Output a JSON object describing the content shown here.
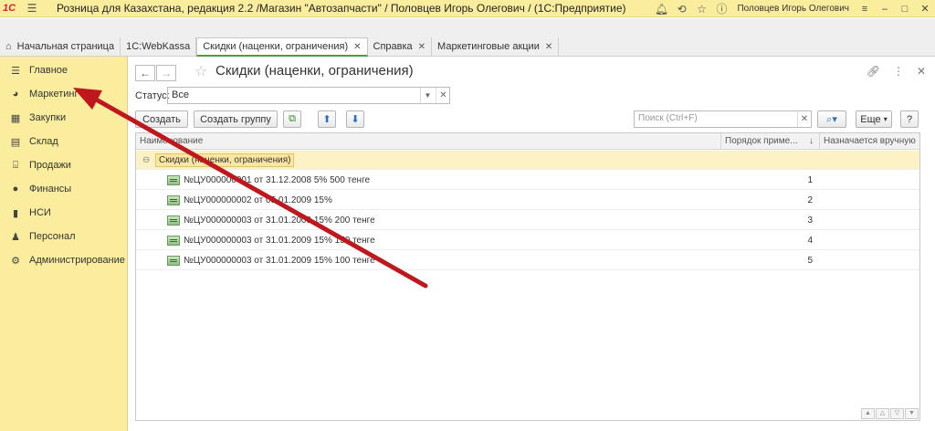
{
  "titlebar": {
    "logo": "1С",
    "title": "Розница для Казахстана, редакция 2.2 /Магазин \"Автозапчасти\" / Половцев Игорь Олегович /",
    "subtitle": "Розница для Казахстана, редакция 2.2 /Магазин \"Автозапчасти\" / Половцев Игорь Олегович / (1С:Предприятие)",
    "user": "Половцев Игорь Олегович"
  },
  "tabs": [
    {
      "label": "Начальная страница"
    },
    {
      "label": "1C:WebKassa"
    },
    {
      "label": "Скидки (наценки, ограничения)"
    },
    {
      "label": "Справка"
    },
    {
      "label": "Маркетинговые акции"
    }
  ],
  "sidebar": {
    "items": [
      {
        "label": "Главное",
        "icon": "menu-icon"
      },
      {
        "label": "Маркетинг",
        "icon": "pie-chart-icon"
      },
      {
        "label": "Закупки",
        "icon": "truck-icon"
      },
      {
        "label": "Склад",
        "icon": "warehouse-icon"
      },
      {
        "label": "Продажи",
        "icon": "cart-icon"
      },
      {
        "label": "Финансы",
        "icon": "coins-icon"
      },
      {
        "label": "НСИ",
        "icon": "book-icon"
      },
      {
        "label": "Персонал",
        "icon": "person-icon"
      },
      {
        "label": "Администрирование",
        "icon": "gear-icon"
      }
    ]
  },
  "main": {
    "title": "Скидки (наценки, ограничения)",
    "status_label": "Статус:",
    "status_value": "Все",
    "buttons": {
      "create": "Создать",
      "create_group": "Создать группу",
      "more": "Еще",
      "help": "?"
    },
    "search_placeholder": "Поиск (Ctrl+F)",
    "columns": {
      "name": "Наименование",
      "order": "Порядок приме...",
      "manual": "Назначается вручную"
    },
    "group_row": "Скидки (наценки, ограничения)",
    "rows": [
      {
        "name": "№ЦУ000000001 от 31.12.2008 5% 500 тенге",
        "order": "1"
      },
      {
        "name": "№ЦУ000000002 от 05.01.2009 15%",
        "order": "2"
      },
      {
        "name": "№ЦУ000000003 от 31.01.2009 15% 200 тенге",
        "order": "3"
      },
      {
        "name": "№ЦУ000000003 от 31.01.2009 15% 150 тенге",
        "order": "4"
      },
      {
        "name": "№ЦУ000000003 от 31.01.2009 15% 100 тенге",
        "order": "5"
      }
    ]
  },
  "colors": {
    "sidebar_bg": "#fbed9e",
    "arrow": "#c0161d",
    "active_tab_underline": "#4b9e43"
  }
}
